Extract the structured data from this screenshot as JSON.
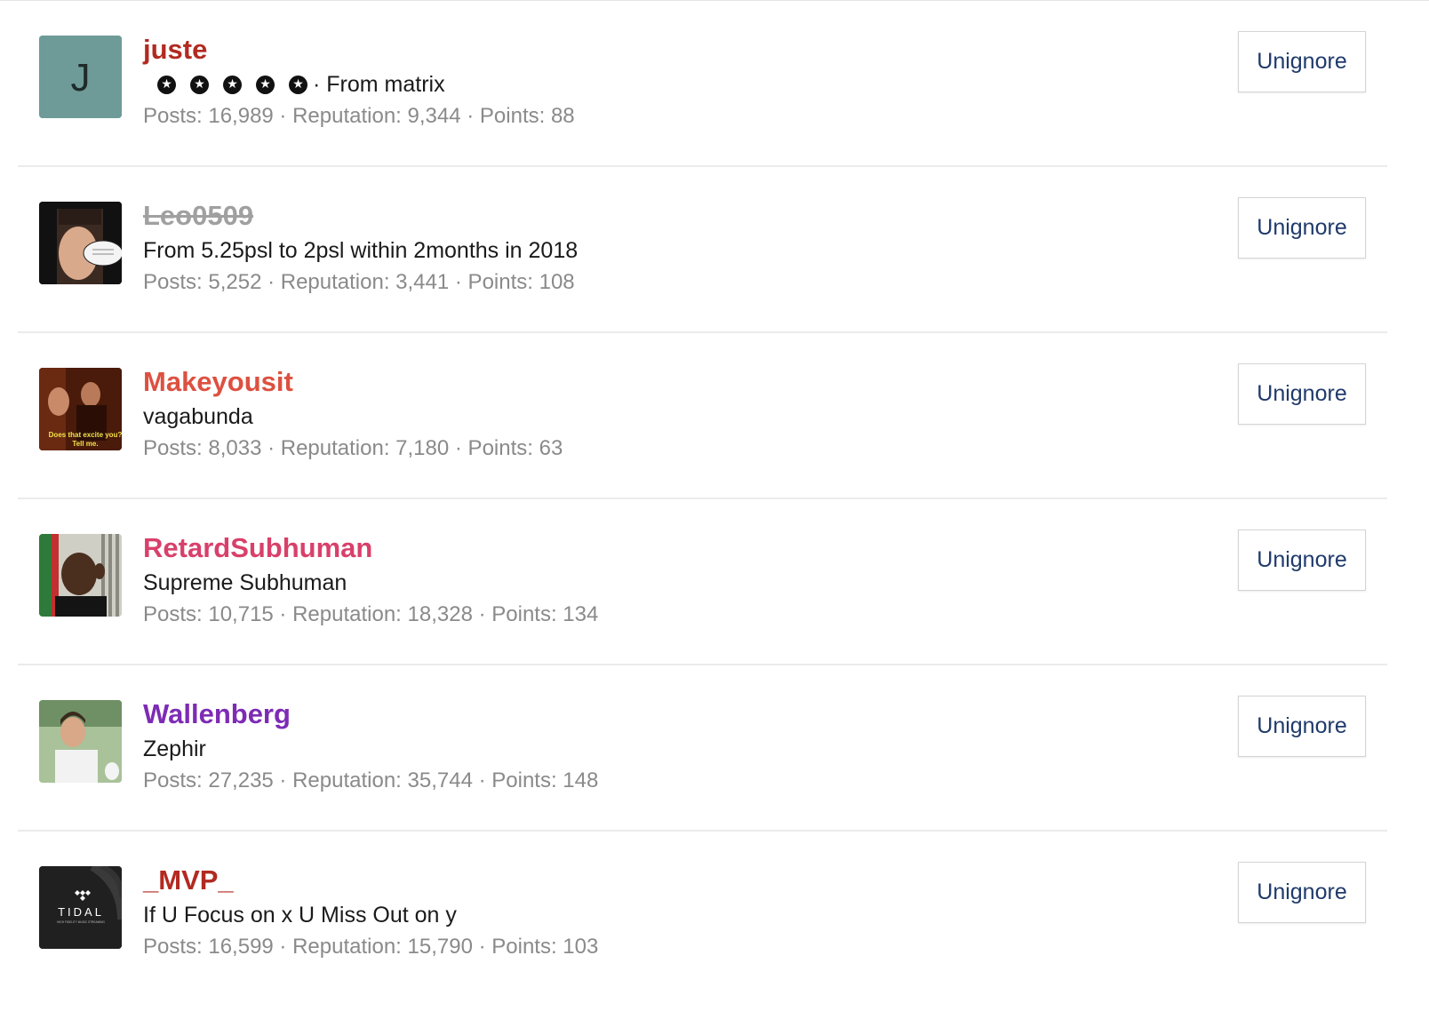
{
  "colors": {
    "juste": "#b22a20",
    "leo": "#a0a0a0",
    "makeyousit": "#dd5040",
    "retard": "#d8406a",
    "wallenberg": "#7d2bb5",
    "mvp": "#b22a20",
    "button_text": "#1f3a6b",
    "stats_text": "#8a8a8a"
  },
  "button_label": "Unignore",
  "star_icon": "star-circle-icon",
  "users": [
    {
      "username": "juste",
      "avatar_letter": "J",
      "stars": 5,
      "title": "· From matrix",
      "stats": "Posts: 16,989 · Reputation: 9,344 · Points: 88"
    },
    {
      "username": "Leo0509",
      "title": "From 5.25psl to 2psl within 2months in 2018",
      "stats": "Posts: 5,252 · Reputation: 3,441 · Points: 108"
    },
    {
      "username": "Makeyousit",
      "avatar_caption_1": "Does that excite you?",
      "avatar_caption_2": "Tell me.",
      "title": "vagabunda",
      "stats": "Posts: 8,033 · Reputation: 7,180 · Points: 63"
    },
    {
      "username": "RetardSubhuman",
      "title": "Supreme Subhuman",
      "stats": "Posts: 10,715 · Reputation: 18,328 · Points: 134"
    },
    {
      "username": "Wallenberg",
      "title": "Zephir",
      "stats": "Posts: 27,235 · Reputation: 35,744 · Points: 148"
    },
    {
      "username": "_MVP_",
      "avatar_logo": "TIDAL",
      "avatar_logo_sub": "HIGH FIDELITY MUSIC STREAMING",
      "title": "If U Focus on x U Miss Out on y",
      "stats": "Posts: 16,599 · Reputation: 15,790 · Points: 103"
    }
  ]
}
